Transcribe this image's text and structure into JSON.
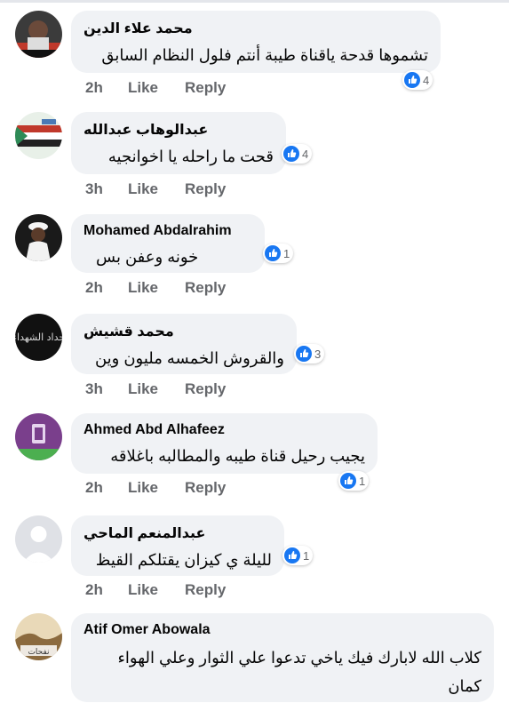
{
  "comments": [
    {
      "name": "محمد علاء الدين",
      "text": "تشموها قدحة ياقناة طيبة أنتم فلول النظام السابق",
      "reactions": "4",
      "time": "2h",
      "like": "Like",
      "reply": "Reply"
    },
    {
      "name": "عبدالوهاب عبدالله",
      "text": "قحت ما راحله يا اخوانجيه",
      "reactions": "4",
      "time": "3h",
      "like": "Like",
      "reply": "Reply"
    },
    {
      "name": "Mohamed Abdalrahim",
      "text": "خونه وعفن بس",
      "reactions": "1",
      "time": "2h",
      "like": "Like",
      "reply": "Reply"
    },
    {
      "name": "محمد قشيش",
      "text": "والقروش الخمسه مليون وين",
      "reactions": "3",
      "time": "3h",
      "like": "Like",
      "reply": "Reply"
    },
    {
      "name": "Ahmed Abd Alhafeez",
      "text": "يجيب رحيل قناة طيبه والمطالبه باغلاقه",
      "reactions": "1",
      "time": "2h",
      "like": "Like",
      "reply": "Reply"
    },
    {
      "name": "عبدالمنعم الماحي",
      "text": "لليلة ي كيزان يقتلكم القيظ",
      "reactions": "1",
      "time": "2h",
      "like": "Like",
      "reply": "Reply"
    },
    {
      "name": "Atif Omer Abowala",
      "text": "كلاب الله لابارك فيك ياخي تدعوا علي الثوار وعلي الهواء كمان",
      "reactions": "",
      "time": "",
      "like": "",
      "reply": ""
    }
  ],
  "avatar_texts": {
    "c4": "حداد الشهداء",
    "c7": "نفحات"
  },
  "colors": {
    "like_blue": "#1877f2",
    "bubble": "#f0f2f5",
    "meta": "#65676b"
  }
}
